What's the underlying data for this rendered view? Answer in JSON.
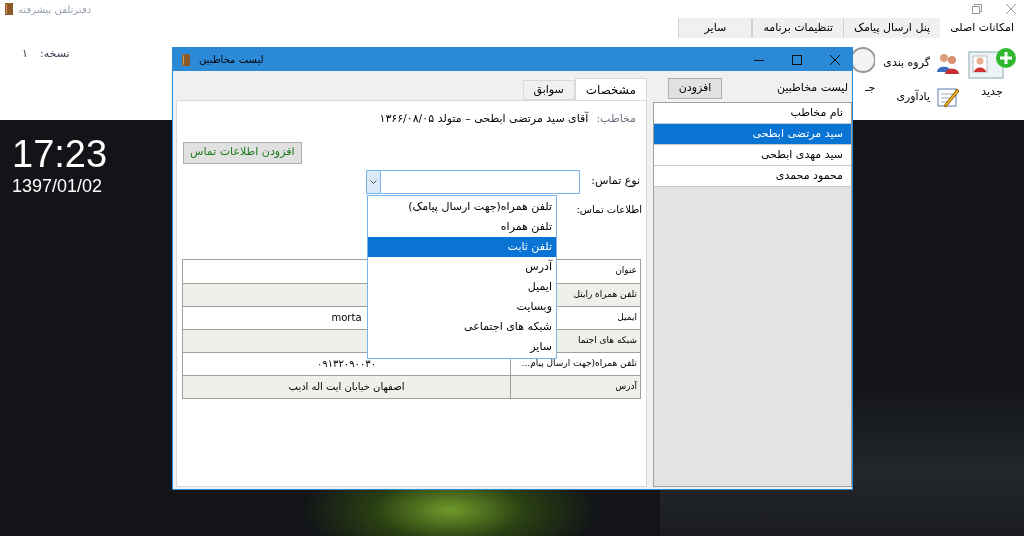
{
  "app": {
    "title": "دفترتلفن پیشرفته"
  },
  "menu_tabs": [
    {
      "label": "امکانات اصلی",
      "selected": true
    },
    {
      "label": "پنل ارسال پیامک",
      "selected": false
    },
    {
      "label": "تنظیمات برنامه",
      "selected": false
    },
    {
      "label": "سایر",
      "selected": false
    }
  ],
  "version": {
    "label": "نسخه:",
    "value": "۱"
  },
  "toolbar": [
    {
      "kind": "new",
      "label": "جدید"
    },
    {
      "kind": "group",
      "label": "گروه بندی"
    },
    {
      "kind": "reminder",
      "label": "یادآوری"
    },
    {
      "kind": "lens",
      "label": "جـ"
    }
  ],
  "clock": {
    "time": "17:23",
    "date": "1397/01/02"
  },
  "dialog": {
    "title": "لیست مخاطبین",
    "tabs": [
      {
        "label": "مشخصات",
        "selected": true
      },
      {
        "label": "سوابق",
        "selected": false
      }
    ],
    "contact": {
      "label": "مخاطب:",
      "value": "آقای سید مرتضی ابطحی – متولد ۱۳۶۶/۰۸/۰۵"
    },
    "add_info_button": "افزودن اطلاعات تماس",
    "contact_type_label": "نوع تماس:",
    "contact_info_label": "اطلاعات تماس:",
    "contact_type_options": [
      {
        "label": "تلفن همراه(جهت ارسال پیامک)",
        "selected": false
      },
      {
        "label": "تلفن همراه",
        "selected": false
      },
      {
        "label": "تلفن ثابت",
        "selected": true
      },
      {
        "label": "آدرس",
        "selected": false
      },
      {
        "label": "ایمیل",
        "selected": false
      },
      {
        "label": "وبسایت",
        "selected": false
      },
      {
        "label": "شبکه های اجتماعی",
        "selected": false
      },
      {
        "label": "سایر",
        "selected": false
      }
    ],
    "table": {
      "rows": [
        {
          "label": "عنوان",
          "value": ""
        },
        {
          "label": "تلفن همراه رایتل",
          "value": ""
        },
        {
          "label": "ایمیل",
          "value": "morta"
        },
        {
          "label": "شبکه های اجتما",
          "value": ""
        },
        {
          "label": "تلفن همراه(جهت ارسال پیام...",
          "value": "۰۹۱۳۲۰۹۰۰۳۰"
        },
        {
          "label": "آدرس",
          "value": "اصفهان خیابان ایت اله ادیب"
        }
      ]
    },
    "list_title": "لیست مخاطبین",
    "add_button": "افزودن",
    "list_header": "نام مخاطب",
    "contacts": [
      {
        "name": "سید مرتضی ابطحی",
        "selected": true
      },
      {
        "name": "سید مهدی ابطحی",
        "selected": false
      },
      {
        "name": "محمود محمدی",
        "selected": false
      }
    ]
  }
}
